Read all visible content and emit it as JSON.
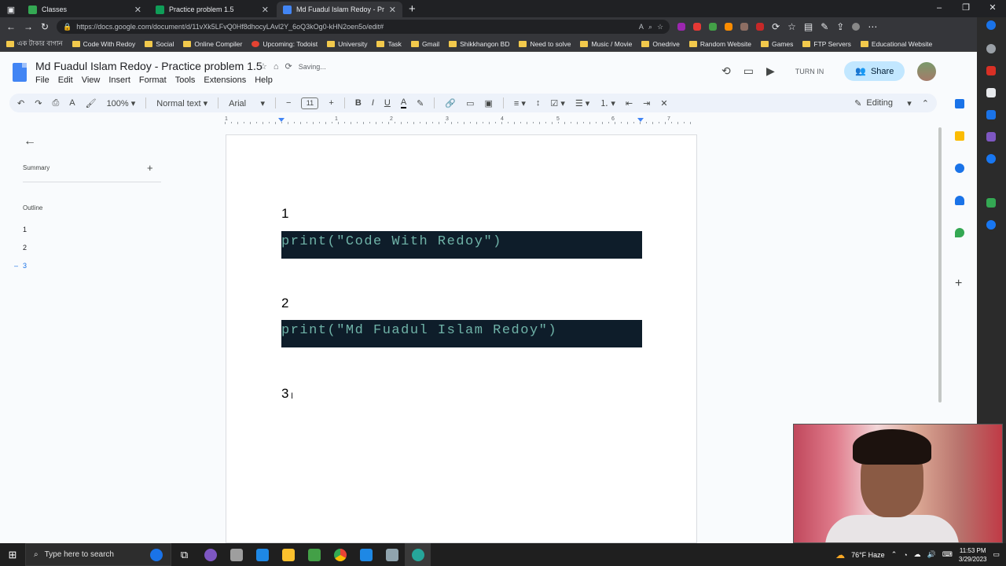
{
  "browser": {
    "tabs": [
      {
        "title": "Classes",
        "color": "#34a853"
      },
      {
        "title": "Practice problem 1.5",
        "color": "#0f9d58"
      },
      {
        "title": "Md Fuadul Islam Redoy - Practic",
        "color": "#4285f4"
      }
    ],
    "url": "https://docs.google.com/document/d/11vXk5LFvQ0Hf8dhocyLAvl2Y_6oQ3kOg0-kHN2oen5o/edit#",
    "bookmarks": [
      "এক টাকার বাগান",
      "Code With Redoy",
      "Social",
      "Online Compiler",
      "Upcoming: Todoist",
      "University",
      "Task",
      "Gmail",
      "Shikkhangon BD",
      "Need to solve",
      "Music / Movie",
      "Onedrive",
      "Random Website",
      "Games",
      "FTP Servers",
      "Educational Website"
    ]
  },
  "docs": {
    "title": "Md Fuadul Islam Redoy - Practice problem 1.5",
    "save_status": "Saving...",
    "menu": [
      "File",
      "Edit",
      "View",
      "Insert",
      "Format",
      "Tools",
      "Extensions",
      "Help"
    ],
    "turn_in": "TURN IN",
    "share": "Share",
    "toolbar": {
      "zoom": "100%",
      "style": "Normal text",
      "font": "Arial",
      "font_size": "11",
      "mode": "Editing"
    },
    "ruler_numbers": [
      "1",
      "1",
      "2",
      "3",
      "4",
      "5",
      "6",
      "7"
    ]
  },
  "outline_panel": {
    "summary_label": "Summary",
    "outline_label": "Outline",
    "items": [
      "1",
      "2",
      "3"
    ]
  },
  "document": {
    "sections": [
      {
        "heading": "1",
        "code_fn": "print(",
        "code_str": "\"Code With Redoy\"",
        "code_end": ")"
      },
      {
        "heading": "2",
        "code_fn": "print(",
        "code_str": "\"Md Fuadul Islam Redoy\"",
        "code_end": ")"
      },
      {
        "heading": "3"
      }
    ],
    "code_bg": "#0e1d2a",
    "code_color": "#6fb3a8"
  },
  "taskbar": {
    "search_placeholder": "Type here to search",
    "weather": "76°F Haze",
    "time": "11:53 PM",
    "date": "3/29/2023"
  }
}
